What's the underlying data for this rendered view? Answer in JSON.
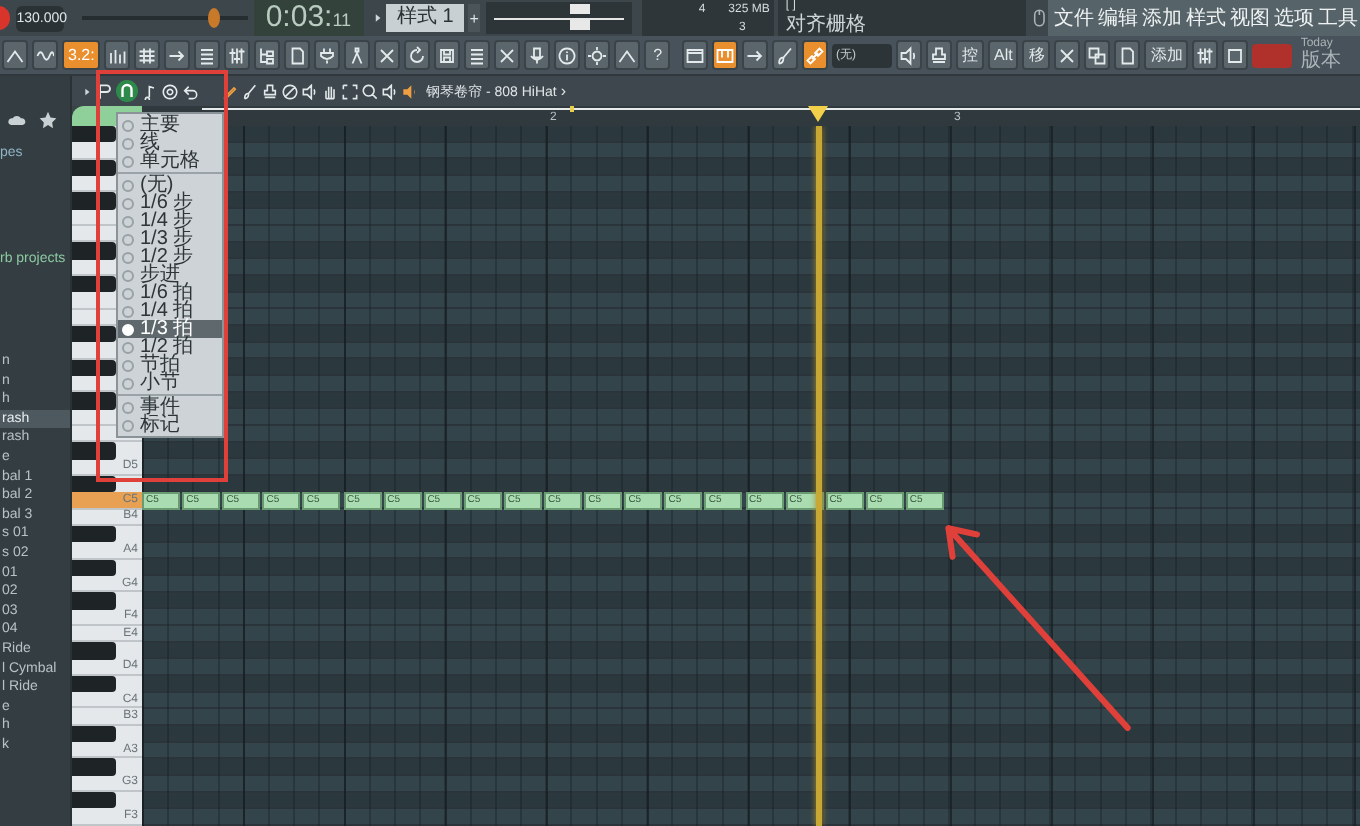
{
  "topbar": {
    "tempo": "130.000",
    "master_slider": {
      "level": 0.8
    },
    "time_main": "0:03:",
    "time_sub": "11",
    "pattern": "样式 1",
    "pattern_add": "+",
    "cpu": "4",
    "ram": "325 MB",
    "poly": "3",
    "hint_top": "[ ]",
    "hint": "对齐栅格"
  },
  "menu": [
    "文件",
    "编辑",
    "添加",
    "样式",
    "视图",
    "选项",
    "工具"
  ],
  "toolbar": {
    "left": [
      {
        "kind": "icon",
        "on": false
      },
      {
        "kind": "icon",
        "on": false
      },
      {
        "kind": "text",
        "label": "3.2:",
        "on": true
      },
      {
        "kind": "icon",
        "on": false
      },
      {
        "kind": "icon",
        "on": false
      },
      {
        "kind": "icon",
        "on": false
      },
      {
        "kind": "icon",
        "on": false
      },
      {
        "kind": "icon",
        "on": false
      },
      {
        "kind": "icon",
        "on": false
      },
      {
        "kind": "icon",
        "on": false
      },
      {
        "kind": "icon",
        "on": false
      },
      {
        "kind": "icon",
        "on": false
      },
      {
        "kind": "icon",
        "on": false
      },
      {
        "kind": "icon",
        "on": false
      },
      {
        "kind": "icon",
        "on": false
      },
      {
        "kind": "icon",
        "on": false
      },
      {
        "kind": "icon",
        "on": false
      },
      {
        "kind": "icon",
        "on": false
      },
      {
        "kind": "icon",
        "on": false
      },
      {
        "kind": "icon",
        "on": false
      },
      {
        "kind": "icon",
        "on": false
      },
      {
        "kind": "text",
        "label": "?",
        "on": false
      }
    ],
    "right": [
      {
        "kind": "icon",
        "on": false
      },
      {
        "kind": "icon",
        "on": true
      },
      {
        "kind": "icon",
        "on": false
      },
      {
        "kind": "icon",
        "on": false
      },
      {
        "kind": "icon",
        "on": true
      },
      {
        "kind": "dropdown",
        "label": "(无)",
        "on": false
      },
      {
        "kind": "icon",
        "on": false
      },
      {
        "kind": "icon",
        "on": false
      },
      {
        "kind": "text",
        "label": "控",
        "on": false
      },
      {
        "kind": "text",
        "label": "Alt",
        "on": false
      },
      {
        "kind": "text",
        "label": "移",
        "on": false
      },
      {
        "kind": "icon",
        "on": false
      },
      {
        "kind": "icon",
        "on": false
      },
      {
        "kind": "icon",
        "on": false
      },
      {
        "kind": "text",
        "label": "添加",
        "on": false
      },
      {
        "kind": "icon",
        "on": false
      },
      {
        "kind": "icon",
        "on": false
      },
      {
        "kind": "flag",
        "on": false
      },
      {
        "kind": "stack",
        "lines": [
          "Today",
          "版本"
        ]
      }
    ]
  },
  "browser": {
    "headings": [
      {
        "label": "pes",
        "kind": "folder"
      },
      {
        "label": "rb projects",
        "kind": "project"
      }
    ],
    "items": [
      {
        "label": "n",
        "selected": false
      },
      {
        "label": "n",
        "selected": false
      },
      {
        "label": "h",
        "selected": false
      },
      {
        "label": "rash",
        "selected": true
      },
      {
        "label": "rash",
        "selected": false
      },
      {
        "label": "e",
        "selected": false
      },
      {
        "label": "bal 1",
        "selected": false
      },
      {
        "label": "bal 2",
        "selected": false
      },
      {
        "label": "bal 3",
        "selected": false
      },
      {
        "label": "s 01",
        "selected": false
      },
      {
        "label": "s 02",
        "selected": false
      },
      {
        "label": "01",
        "selected": false
      },
      {
        "label": "02",
        "selected": false
      },
      {
        "label": "03",
        "selected": false
      },
      {
        "label": "04",
        "selected": false
      },
      {
        "label": "Ride",
        "selected": false
      },
      {
        "label": "l Cymbal",
        "selected": false
      },
      {
        "label": "l Ride",
        "selected": false
      },
      {
        "label": "e",
        "selected": false
      },
      {
        "label": "h",
        "selected": false
      },
      {
        "label": "k",
        "selected": false
      }
    ]
  },
  "piano_roll": {
    "title": "钢琴卷帘 - 808 HiHat",
    "title_arrow": "›",
    "ruler": [
      "2",
      "3"
    ],
    "keys": [
      {
        "label": "D5",
        "selected": false
      },
      {
        "label": "C5",
        "selected": true
      },
      {
        "label": "B4",
        "selected": false
      },
      {
        "label": "A4",
        "selected": false
      },
      {
        "label": "G4",
        "selected": false
      },
      {
        "label": "F4",
        "selected": false
      },
      {
        "label": "E4",
        "selected": false
      },
      {
        "label": "D4",
        "selected": false
      },
      {
        "label": "C4",
        "selected": false
      },
      {
        "label": "B3",
        "selected": false
      },
      {
        "label": "A3",
        "selected": false
      },
      {
        "label": "G3",
        "selected": false
      },
      {
        "label": "F3",
        "selected": false
      }
    ],
    "notes": [
      {
        "label": "C5"
      },
      {
        "label": "C5"
      },
      {
        "label": "C5"
      },
      {
        "label": "C5"
      },
      {
        "label": "C5"
      },
      {
        "label": "C5"
      },
      {
        "label": "C5"
      },
      {
        "label": "C5"
      },
      {
        "label": "C5"
      },
      {
        "label": "C5"
      },
      {
        "label": "C5"
      },
      {
        "label": "C5"
      },
      {
        "label": "C5"
      },
      {
        "label": "C5"
      },
      {
        "label": "C5"
      },
      {
        "label": "C5"
      },
      {
        "label": "C5"
      },
      {
        "label": "C5"
      },
      {
        "label": "C5"
      },
      {
        "label": "C5"
      }
    ]
  },
  "snap_menu": {
    "items": [
      {
        "kind": "item",
        "label": "主要",
        "selected": false
      },
      {
        "kind": "item",
        "label": "线",
        "selected": false
      },
      {
        "kind": "item",
        "label": "单元格",
        "selected": false
      },
      {
        "kind": "separator"
      },
      {
        "kind": "item",
        "label": "(无)",
        "selected": false
      },
      {
        "kind": "item",
        "label": "1/6 步",
        "selected": false
      },
      {
        "kind": "item",
        "label": "1/4 步",
        "selected": false
      },
      {
        "kind": "item",
        "label": "1/3 步",
        "selected": false
      },
      {
        "kind": "item",
        "label": "1/2 步",
        "selected": false
      },
      {
        "kind": "item",
        "label": "步进",
        "selected": false
      },
      {
        "kind": "item",
        "label": "1/6 拍",
        "selected": false
      },
      {
        "kind": "item",
        "label": "1/4 拍",
        "selected": false
      },
      {
        "kind": "item",
        "label": "1/3 拍",
        "selected": true
      },
      {
        "kind": "item",
        "label": "1/2 拍",
        "selected": false
      },
      {
        "kind": "item",
        "label": "节拍",
        "selected": false
      },
      {
        "kind": "item",
        "label": "小节",
        "selected": false
      },
      {
        "kind": "separator"
      },
      {
        "kind": "item",
        "label": "事件",
        "selected": false
      },
      {
        "kind": "item",
        "label": "标记",
        "selected": false
      }
    ]
  }
}
